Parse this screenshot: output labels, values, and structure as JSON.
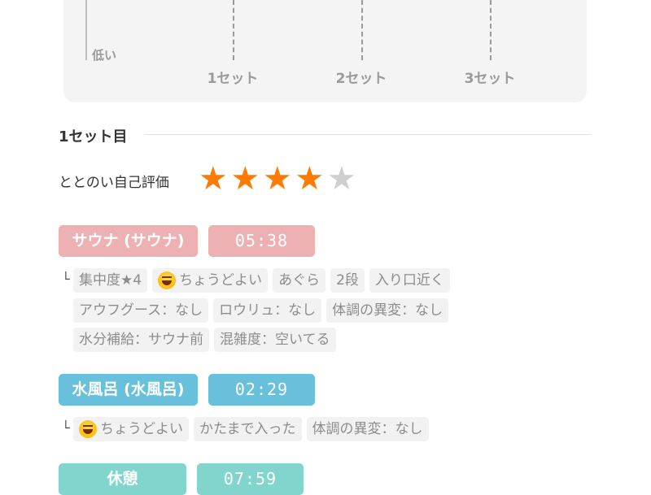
{
  "chart": {
    "low_label": "低い",
    "x_labels": [
      "1セット",
      "2セット",
      "3セット"
    ]
  },
  "set": {
    "title": "1セット目",
    "rating_label": "ととのい自己評価",
    "rating_value": 4,
    "rating_max": 5
  },
  "phases": [
    {
      "label": "サウナ (サウナ)",
      "time": "05:38",
      "tags": [
        [
          "集中度★4",
          "ちょうどよい",
          "あぐら",
          "2段",
          "入り口近く"
        ],
        [
          "アウフグース：なし",
          "ロウリュ：なし",
          "体調の異変：なし"
        ],
        [
          "水分補給：サウナ前",
          "混雑度：空いてる"
        ]
      ]
    },
    {
      "label": "水風呂 (水風呂)",
      "time": "02:29",
      "tags": [
        [
          "ちょうどよい",
          "かたまで入った",
          "体調の異変：なし"
        ]
      ]
    },
    {
      "label": "休憩",
      "time": "07:59"
    }
  ],
  "branch_symbol": "└",
  "colors": {
    "sauna": "#eeb1b3",
    "water": "#68c0db",
    "rest": "#81d5cc",
    "star_on": "#ff7a00",
    "star_off": "#cfcfcf"
  }
}
